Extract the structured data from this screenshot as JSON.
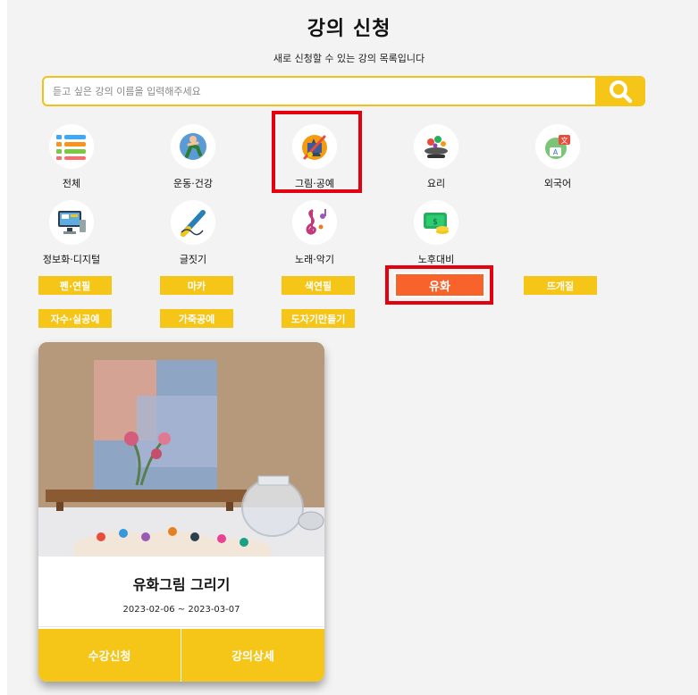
{
  "page": {
    "title": "강의 신청",
    "subtitle": "새로 신청할 수 있는 강의 목록입니다"
  },
  "search": {
    "placeholder": "듣고 싶은 강의 이름을 입력해주세요",
    "icon": "search-icon"
  },
  "categories": [
    {
      "label": "전체",
      "icon": "list-icon"
    },
    {
      "label": "운동·건강",
      "icon": "exercise-icon"
    },
    {
      "label": "그림·공예",
      "icon": "art-icon",
      "selected": true
    },
    {
      "label": "요리",
      "icon": "cooking-icon"
    },
    {
      "label": "외국어",
      "icon": "language-icon"
    },
    {
      "label": "정보화·디지털",
      "icon": "computer-icon"
    },
    {
      "label": "글짓기",
      "icon": "pen-icon"
    },
    {
      "label": "노래·악기",
      "icon": "music-icon"
    },
    {
      "label": "노후대비",
      "icon": "money-icon"
    }
  ],
  "subcategories": [
    {
      "label": "펜·연필"
    },
    {
      "label": "마카"
    },
    {
      "label": "색연필"
    },
    {
      "label": "유화",
      "active": true
    },
    {
      "label": "뜨개질"
    },
    {
      "label": "자수·실공예"
    },
    {
      "label": "가죽공예"
    },
    {
      "label": "도자기만들기"
    }
  ],
  "course": {
    "title": "유화그림 그리기",
    "dates": "2023-02-06 ~ 2023-03-07",
    "enroll_label": "수강신청",
    "detail_label": "강의상세"
  },
  "colors": {
    "accent": "#f5c518",
    "active_chip": "#f7632a",
    "highlight": "#e3000f"
  }
}
